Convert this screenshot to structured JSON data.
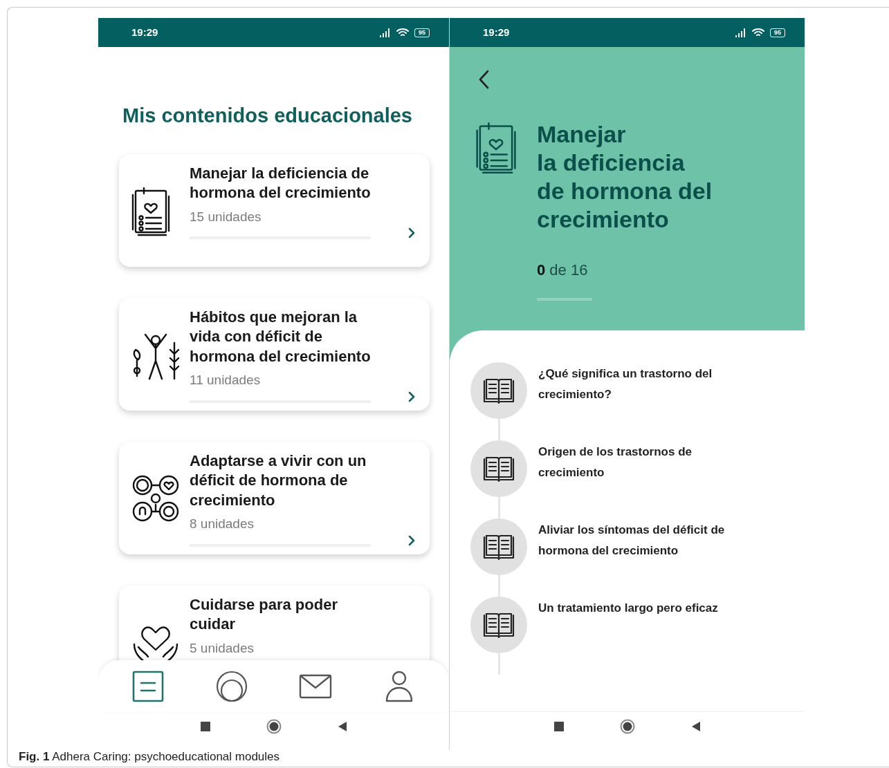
{
  "screens": [
    {
      "kind": "module-list",
      "status_bar": {
        "time": "19:29",
        "battery": "95"
      },
      "title": "Mis contenidos educacionales",
      "modules": [
        {
          "title": "Manejar la deficiencia de hormona del crecimiento",
          "units": "15 unidades",
          "level": 0
        },
        {
          "title": "Hábitos que mejoran la vida con déficit de hormona del crecimiento",
          "units": "11 unidades",
          "level": 0
        },
        {
          "title": "Adaptarse a vivir con un déficit de hormona de crecimiento",
          "units": "8 unidades",
          "level": 0
        },
        {
          "title": "Cuidarse para poder cuidar",
          "units": "5 unidades"
        }
      ],
      "bottom_nav": [
        {
          "selected": true
        },
        {
          "selected": false
        },
        {
          "selected": false
        },
        {
          "selected": false
        }
      ]
    },
    {
      "kind": "module-detail",
      "status_bar": {
        "time": "19:29",
        "battery": "95"
      },
      "title": "Manejar\nla deficiencia\nde hormona del\ncrecimiento",
      "progress": {
        "done": "0",
        "total": "de 16",
        "level": 0
      },
      "units": [
        {
          "title": "¿Qué significa un trastorno del crecimiento?"
        },
        {
          "title": "Origen de los trastornos de crecimiento"
        },
        {
          "title": "Aliviar los síntomas del déficit de hormona del crecimiento"
        },
        {
          "title": "Un tratamiento largo pero eficaz"
        }
      ]
    }
  ],
  "caption": "**Fig. 1** Adhera Caring: psychoeducational modules"
}
